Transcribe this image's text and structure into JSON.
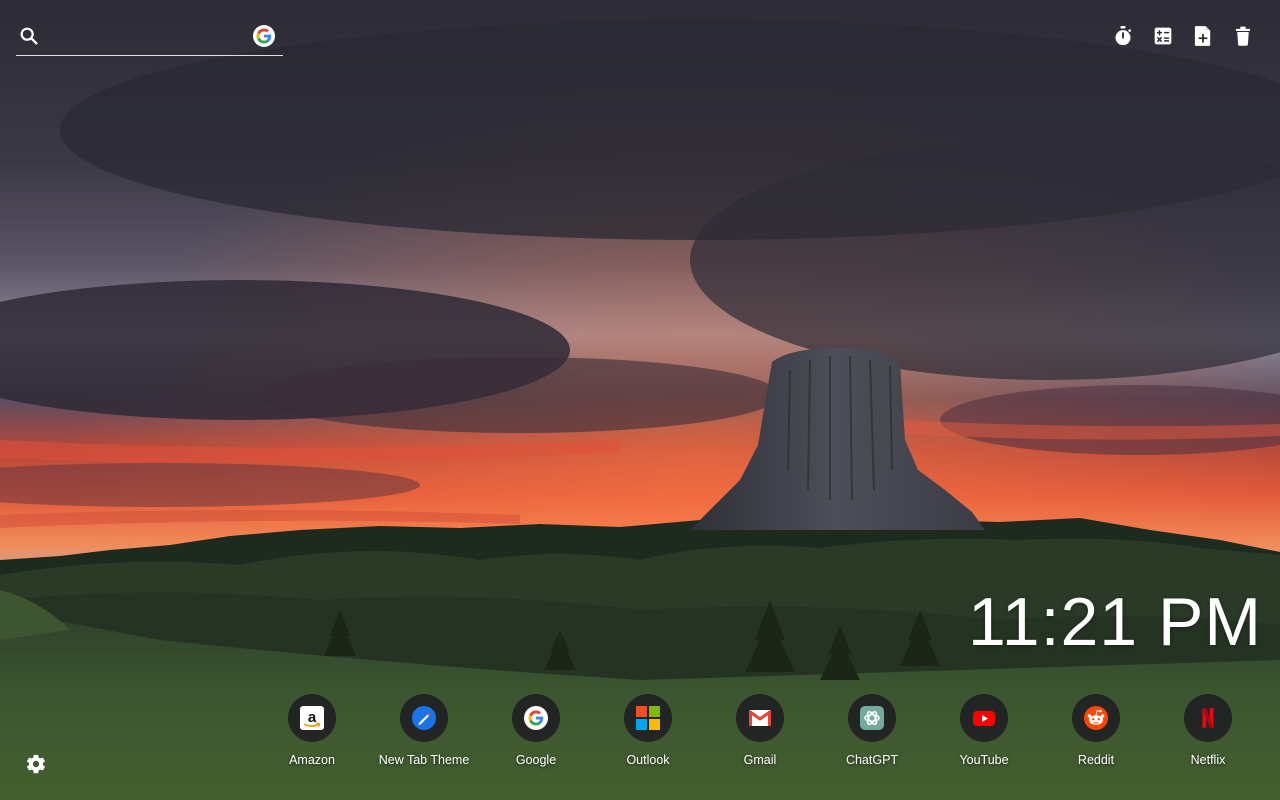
{
  "search": {
    "value": "",
    "placeholder": "",
    "icon": "search-icon",
    "engine_icon": "google-icon"
  },
  "tools": [
    {
      "name": "timer",
      "icon": "stopwatch-icon"
    },
    {
      "name": "calculator",
      "icon": "calculator-icon"
    },
    {
      "name": "new-note",
      "icon": "note-add-icon"
    },
    {
      "name": "trash",
      "icon": "trash-icon"
    }
  ],
  "clock": {
    "time": "11:21 PM"
  },
  "shortcuts": [
    {
      "label": "Amazon",
      "icon": "amazon-icon"
    },
    {
      "label": "New Tab Theme",
      "icon": "new-tab-theme-icon"
    },
    {
      "label": "Google",
      "icon": "google-icon"
    },
    {
      "label": "Outlook",
      "icon": "outlook-icon"
    },
    {
      "label": "Gmail",
      "icon": "gmail-icon"
    },
    {
      "label": "ChatGPT",
      "icon": "chatgpt-icon"
    },
    {
      "label": "YouTube",
      "icon": "youtube-icon"
    },
    {
      "label": "Reddit",
      "icon": "reddit-icon"
    },
    {
      "label": "Netflix",
      "icon": "netflix-icon"
    }
  ],
  "settings": {
    "icon": "gear-icon"
  },
  "colors": {
    "text": "#ffffff",
    "tile_bg": "#202124",
    "sky_glow": "#e8553a",
    "grass": "#3f5a30"
  }
}
